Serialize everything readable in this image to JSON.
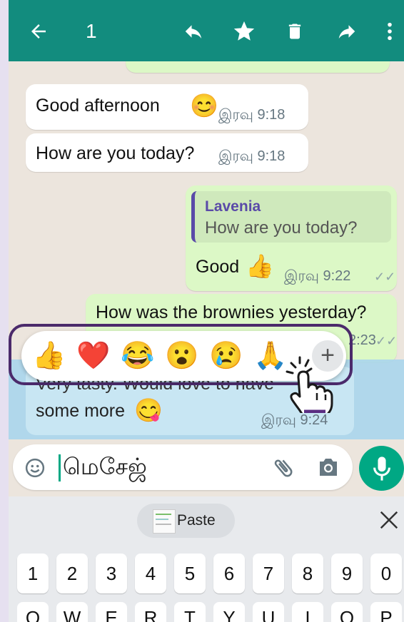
{
  "toolbar": {
    "selected_count": "1",
    "icons": [
      "back-arrow-icon",
      "reply-icon",
      "star-icon",
      "delete-icon",
      "forward-icon",
      "more-vert-icon"
    ]
  },
  "messages": {
    "m1": {
      "text": "Good afternoon",
      "emoji": "😊",
      "time": "இரவு 9:18"
    },
    "m2": {
      "text": "How are you today?",
      "time": "இரவு 9:18"
    },
    "m3": {
      "quote_name": "Lavenia",
      "quote_text": "How are you today?",
      "text": "Good",
      "emoji": "👍",
      "time": "இரவு 9:22"
    },
    "m4": {
      "text": "How was the brownies yesterday?",
      "time_partial": "2:23"
    },
    "m5": {
      "text_line1": "Very tasty. Would love to have",
      "text_line2": "some more",
      "emoji": "😋",
      "time": "இரவு 9:24"
    }
  },
  "reactions": {
    "items": [
      "👍",
      "❤️",
      "😂",
      "😮",
      "😢",
      "🙏"
    ],
    "more": "+"
  },
  "input": {
    "placeholder": "மெசேஜ்"
  },
  "keyboard": {
    "paste_label": "Paste",
    "number_row": [
      "1",
      "2",
      "3",
      "4",
      "5",
      "6",
      "7",
      "8",
      "9",
      "0"
    ],
    "letter_row": [
      "Q",
      "W",
      "E",
      "R",
      "T",
      "Y",
      "U",
      "I",
      "O",
      "P"
    ]
  },
  "colors": {
    "toolbar": "#128c7e",
    "outgoing_bubble": "#dcf8c6",
    "incoming_bubble": "#ffffff",
    "selection": "#aad6ec",
    "quote_accent": "#5a4aa8",
    "mic_button": "#00a884"
  }
}
